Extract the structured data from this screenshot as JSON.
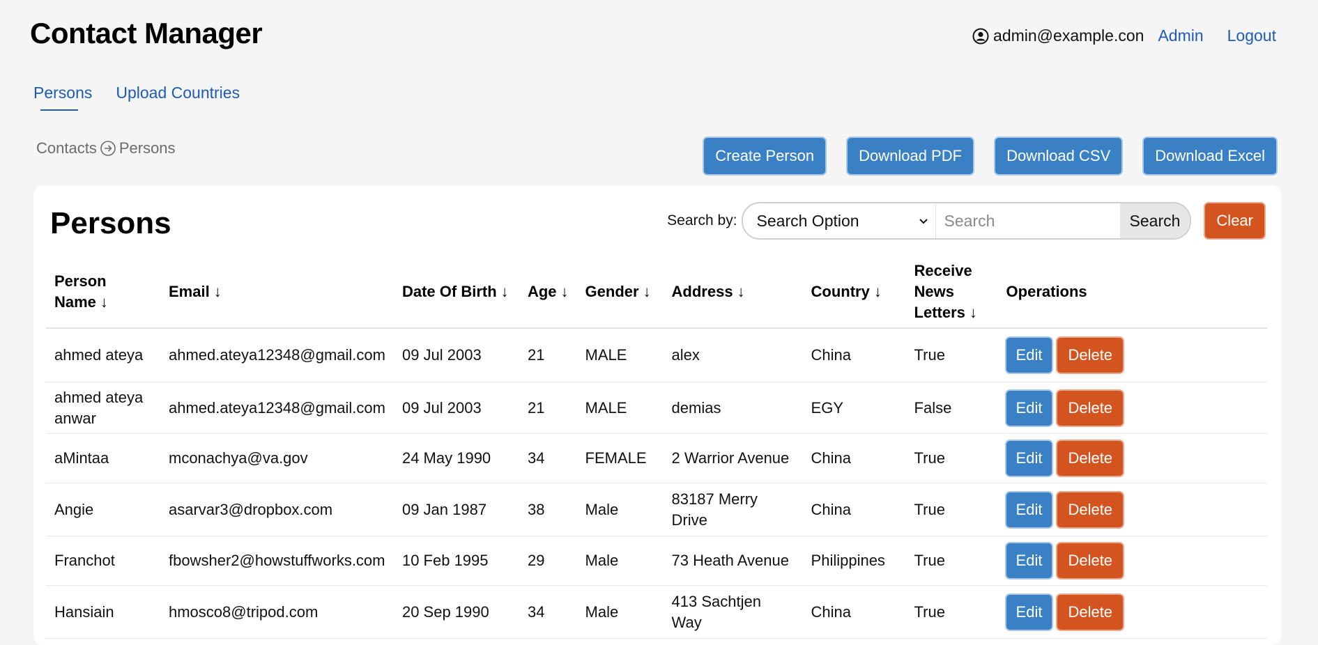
{
  "app": {
    "title": "Contact Manager"
  },
  "user": {
    "email": "admin@example.con",
    "admin_label": "Admin",
    "logout_label": "Logout"
  },
  "nav": {
    "tabs": [
      {
        "label": "Persons"
      },
      {
        "label": "Upload Countries"
      }
    ]
  },
  "breadcrumb": {
    "parent": "Contacts",
    "current": "Persons"
  },
  "actions": {
    "create": "Create Person",
    "pdf": "Download PDF",
    "csv": "Download CSV",
    "excel": "Download Excel"
  },
  "card": {
    "title": "Persons"
  },
  "search": {
    "label": "Search by:",
    "option": "Search Option",
    "placeholder": "Search",
    "button": "Search",
    "clear": "Clear"
  },
  "table": {
    "sort_arrow": "↓",
    "columns": [
      {
        "label": "Person Name",
        "sortable": true
      },
      {
        "label": "Email",
        "sortable": true
      },
      {
        "label": "Date Of Birth",
        "sortable": true
      },
      {
        "label": "Age",
        "sortable": true
      },
      {
        "label": "Gender",
        "sortable": true
      },
      {
        "label": "Address",
        "sortable": true
      },
      {
        "label": "Country",
        "sortable": true
      },
      {
        "label": "Receive News Letters",
        "sortable": true
      },
      {
        "label": "Operations",
        "sortable": false
      }
    ],
    "edit_label": "Edit",
    "delete_label": "Delete",
    "rows": [
      {
        "name": "ahmed ateya",
        "email": "ahmed.ateya12348@gmail.com",
        "dob": "09 Jul 2003",
        "age": "21",
        "gender": "MALE",
        "address": "alex",
        "country": "China",
        "news": "True"
      },
      {
        "name": "ahmed ateya anwar",
        "email": "ahmed.ateya12348@gmail.com",
        "dob": "09 Jul 2003",
        "age": "21",
        "gender": "MALE",
        "address": "demias",
        "country": "EGY",
        "news": "False"
      },
      {
        "name": "aMintaa",
        "email": "mconachya@va.gov",
        "dob": "24 May 1990",
        "age": "34",
        "gender": "FEMALE",
        "address": "2 Warrior Avenue",
        "country": "China",
        "news": "True"
      },
      {
        "name": "Angie",
        "email": "asarvar3@dropbox.com",
        "dob": "09 Jan 1987",
        "age": "38",
        "gender": "Male",
        "address": "83187 Merry Drive",
        "country": "China",
        "news": "True"
      },
      {
        "name": "Franchot",
        "email": "fbowsher2@howstuffworks.com",
        "dob": "10 Feb 1995",
        "age": "29",
        "gender": "Male",
        "address": "73 Heath Avenue",
        "country": "Philippines",
        "news": "True"
      },
      {
        "name": "Hansiain",
        "email": "hmosco8@tripod.com",
        "dob": "20 Sep 1990",
        "age": "34",
        "gender": "Male",
        "address": "413 Sachtjen Way",
        "country": "China",
        "news": "True"
      }
    ]
  }
}
